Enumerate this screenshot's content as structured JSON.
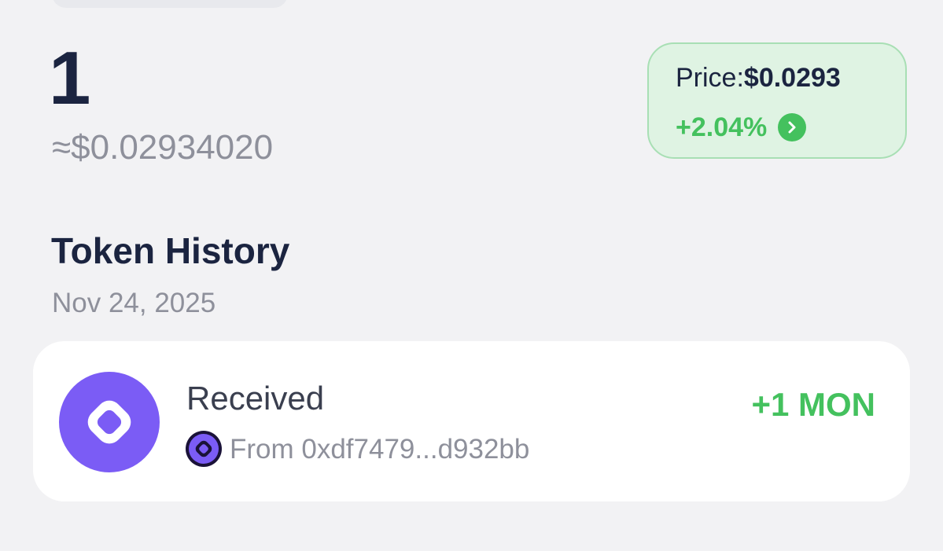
{
  "balance": {
    "amount": "1",
    "fiat": "≈$0.02934020"
  },
  "price_card": {
    "label": "Price:",
    "value": "$0.0293",
    "change": "+2.04%",
    "change_icon": "chevron-right-icon",
    "colors": {
      "background": "#dff3e3",
      "border": "#a8dfb4",
      "positive": "#44c15e"
    }
  },
  "history": {
    "title": "Token History",
    "date": "Nov 24, 2025",
    "transactions": [
      {
        "type": "Received",
        "from": "From 0xdf7479...d932bb",
        "amount": "+1 MON",
        "icon": "monad-token-icon"
      }
    ]
  },
  "colors": {
    "accent": "#7b5cf5",
    "text_primary": "#1b2440",
    "text_secondary": "#8e909b"
  }
}
